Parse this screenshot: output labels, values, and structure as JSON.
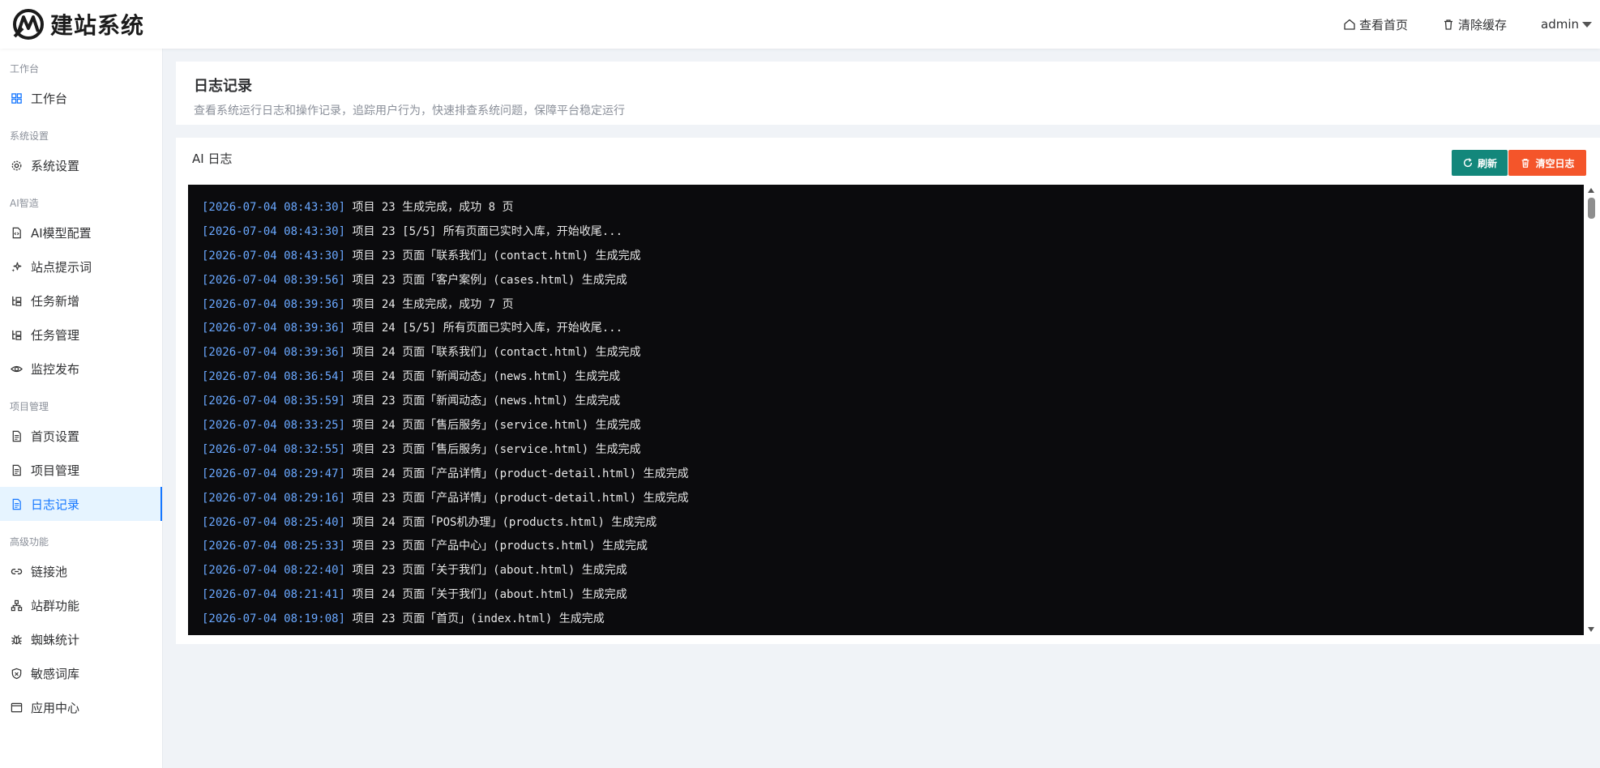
{
  "header": {
    "logo_text": "建站系统",
    "view_home": "查看首页",
    "clear_cache": "清除缓存",
    "user": "admin"
  },
  "sidebar": {
    "groups": [
      {
        "title": "工作台",
        "items": [
          {
            "label": "工作台",
            "icon": "dashboard-icon"
          }
        ]
      },
      {
        "title": "系统设置",
        "items": [
          {
            "label": "系统设置",
            "icon": "gear-icon"
          }
        ]
      },
      {
        "title": "AI智造",
        "items": [
          {
            "label": "AI模型配置",
            "icon": "file-code-icon"
          },
          {
            "label": "站点提示词",
            "icon": "sparkle-icon"
          },
          {
            "label": "任务新增",
            "icon": "task-tree-icon"
          },
          {
            "label": "任务管理",
            "icon": "task-tree-icon"
          },
          {
            "label": "监控发布",
            "icon": "eye-icon"
          }
        ]
      },
      {
        "title": "项目管理",
        "items": [
          {
            "label": "首页设置",
            "icon": "document-icon"
          },
          {
            "label": "项目管理",
            "icon": "document-icon"
          },
          {
            "label": "日志记录",
            "icon": "document-icon",
            "active": true
          }
        ]
      },
      {
        "title": "高级功能",
        "items": [
          {
            "label": "链接池",
            "icon": "link-icon"
          },
          {
            "label": "站群功能",
            "icon": "cluster-icon"
          },
          {
            "label": "蜘蛛统计",
            "icon": "bug-icon"
          },
          {
            "label": "敏感词库",
            "icon": "shield-icon"
          },
          {
            "label": "应用中心",
            "icon": "window-icon"
          }
        ]
      }
    ]
  },
  "page": {
    "title": "日志记录",
    "description": "查看系统运行日志和操作记录，追踪用户行为，快速排查系统问题，保障平台稳定运行"
  },
  "log_card": {
    "title": "AI 日志",
    "refresh_label": "刷新",
    "clear_label": "清空日志",
    "lines": [
      {
        "time": "[2026-07-04 08:43:30]",
        "text": " 项目 23 生成完成，成功 8 页"
      },
      {
        "time": "[2026-07-04 08:43:30]",
        "text": " 项目 23 [5/5] 所有页面已实时入库，开始收尾..."
      },
      {
        "time": "[2026-07-04 08:43:30]",
        "text": " 项目 23 页面「联系我们」(contact.html) 生成完成"
      },
      {
        "time": "[2026-07-04 08:39:56]",
        "text": " 项目 23 页面「客户案例」(cases.html) 生成完成"
      },
      {
        "time": "[2026-07-04 08:39:36]",
        "text": " 项目 24 生成完成，成功 7 页"
      },
      {
        "time": "[2026-07-04 08:39:36]",
        "text": " 项目 24 [5/5] 所有页面已实时入库，开始收尾..."
      },
      {
        "time": "[2026-07-04 08:39:36]",
        "text": " 项目 24 页面「联系我们」(contact.html) 生成完成"
      },
      {
        "time": "[2026-07-04 08:36:54]",
        "text": " 项目 24 页面「新闻动态」(news.html) 生成完成"
      },
      {
        "time": "[2026-07-04 08:35:59]",
        "text": " 项目 23 页面「新闻动态」(news.html) 生成完成"
      },
      {
        "time": "[2026-07-04 08:33:25]",
        "text": " 项目 24 页面「售后服务」(service.html) 生成完成"
      },
      {
        "time": "[2026-07-04 08:32:55]",
        "text": " 项目 23 页面「售后服务」(service.html) 生成完成"
      },
      {
        "time": "[2026-07-04 08:29:47]",
        "text": " 项目 24 页面「产品详情」(product-detail.html) 生成完成"
      },
      {
        "time": "[2026-07-04 08:29:16]",
        "text": " 项目 23 页面「产品详情」(product-detail.html) 生成完成"
      },
      {
        "time": "[2026-07-04 08:25:40]",
        "text": " 项目 24 页面「POS机办理」(products.html) 生成完成"
      },
      {
        "time": "[2026-07-04 08:25:33]",
        "text": " 项目 23 页面「产品中心」(products.html) 生成完成"
      },
      {
        "time": "[2026-07-04 08:22:40]",
        "text": " 项目 23 页面「关于我们」(about.html) 生成完成"
      },
      {
        "time": "[2026-07-04 08:21:41]",
        "text": " 项目 24 页面「关于我们」(about.html) 生成完成"
      },
      {
        "time": "[2026-07-04 08:19:08]",
        "text": " 项目 23 页面「首页」(index.html) 生成完成"
      }
    ]
  }
}
